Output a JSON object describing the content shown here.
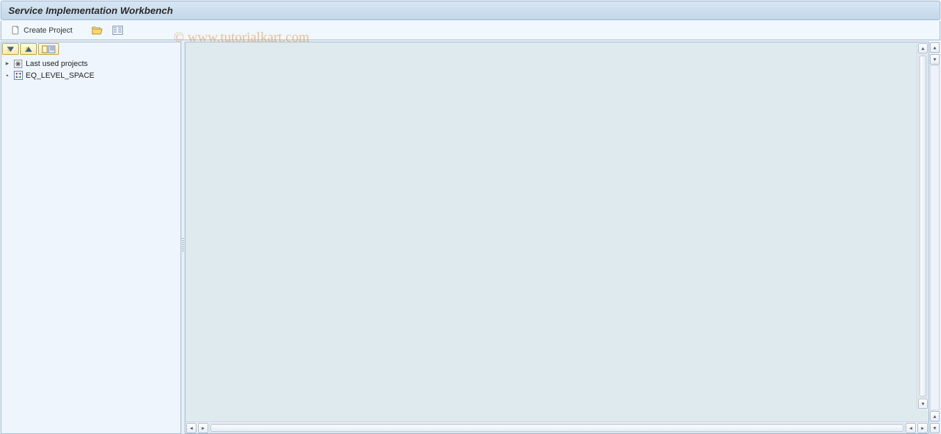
{
  "header": {
    "title": "Service Implementation Workbench"
  },
  "toolbar": {
    "create_project_label": "Create Project"
  },
  "watermark": "© www.tutorialkart.com",
  "tree_toolbar": {
    "expand_tip": "Expand",
    "collapse_tip": "Collapse",
    "layout_tip": "Layout"
  },
  "tree": {
    "items": [
      {
        "label": "Last used projects",
        "icon": "asterisk",
        "expandable": true
      },
      {
        "label": "EQ_LEVEL_SPACE",
        "icon": "nodes",
        "expandable": false
      }
    ]
  }
}
